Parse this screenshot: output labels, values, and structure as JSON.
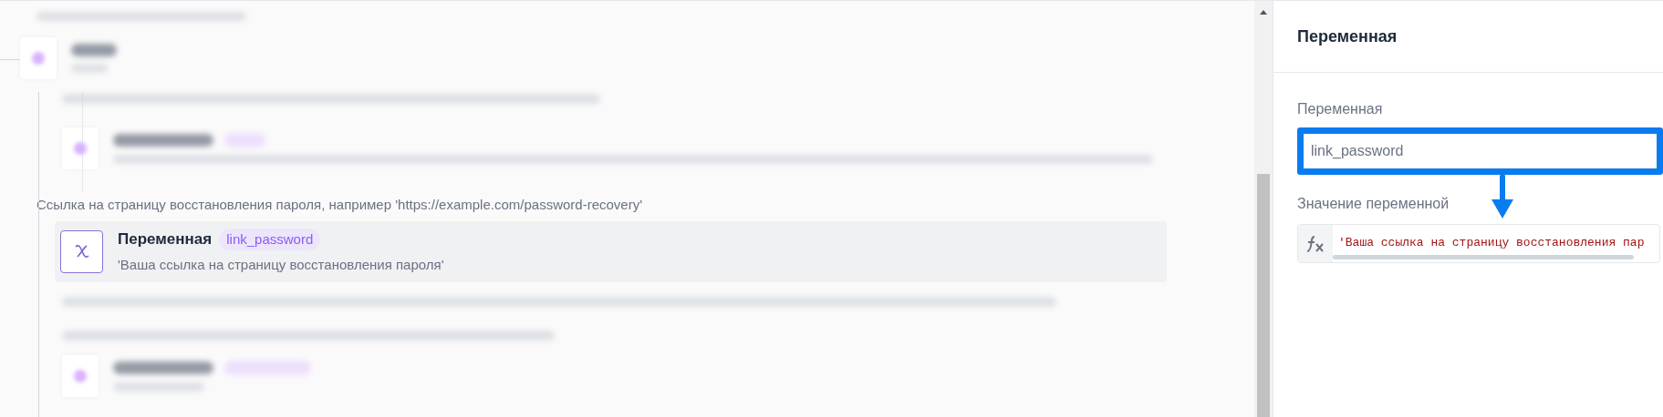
{
  "flow": {
    "description": "Ссылка на страницу восстановления пароля, например 'https://example.com/password-recovery'",
    "selected_step": {
      "title": "Переменная",
      "badge": "link_password",
      "subtitle": "'Ваша ссылка на страницу восстановления пароля'"
    }
  },
  "panel": {
    "title": "Переменная",
    "variable_label": "Переменная",
    "variable_value": "link_password",
    "value_label": "Значение переменной",
    "value_code": "'Ваша ссылка на страницу восстановления пар"
  }
}
